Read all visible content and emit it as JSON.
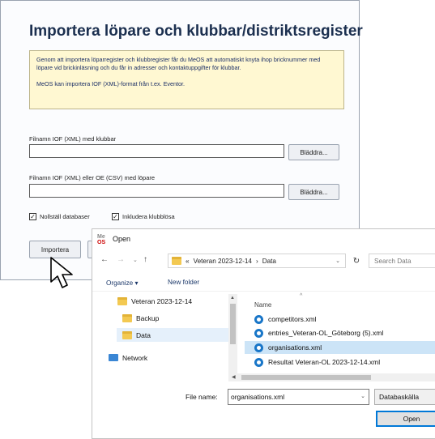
{
  "meos": {
    "title": "Importera löpare och klubbar/distriktsregister",
    "info_paragraph_1": "Genom att importera löparregister och klubbregister får du MeOS att automatiskt knyta ihop bricknummer med löpare vid brickinläsning och du får in adresser och kontaktuppgifter för klubbar.",
    "info_paragraph_2": "MeOS kan importera IOF (XML)-format från t.ex. Eventor.",
    "clubs_label": "Filnamn IOF (XML) med klubbar",
    "clubs_value": "",
    "runners_label": "Filnamn IOF (XML) eller OE (CSV) med löpare",
    "runners_value": "",
    "browse_label": "Bläddra...",
    "reset_db_label": "Nollställ databaser",
    "include_clubless_label": "Inkludera klubblösa",
    "import_label": "Importera"
  },
  "dialog": {
    "title": "Open",
    "app_icon_top": "Me",
    "app_icon_bottom": "OS",
    "breadcrumb_prefix": "«",
    "breadcrumb_folder": "Veteran 2023-12-14",
    "breadcrumb_separator": "›",
    "breadcrumb_current": "Data",
    "search_placeholder": "Search Data",
    "organize_label": "Organize ▾",
    "new_folder_label": "New folder",
    "nav_items": [
      "Veteran 2023-12-14",
      "Backup",
      "Data",
      "Network"
    ],
    "column_name": "Name",
    "files": [
      "competitors.xml",
      "entries_Veteran-OL_Göteborg (5).xml",
      "organisations.xml",
      "Resultat Veteran-OL 2023-12-14.xml"
    ],
    "file_name_label": "File name:",
    "file_name_value": "organisations.xml",
    "file_type_label": "Databaskälla",
    "open_label": "Open"
  },
  "colors": {
    "title": "#1b2f4f",
    "info_bg": "#fff8d2",
    "selection": "#cce4f7",
    "accent": "#0078d7"
  }
}
